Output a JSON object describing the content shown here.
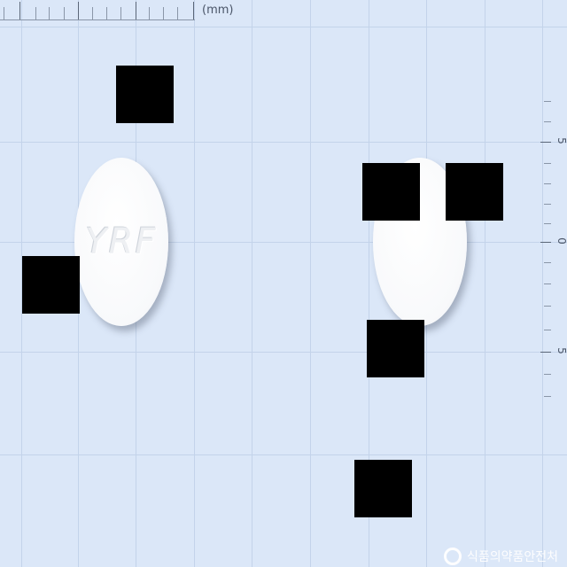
{
  "ruler": {
    "unit_label": "(mm)",
    "right_labels": [
      "5",
      "0",
      "5"
    ]
  },
  "pills": [
    {
      "name": "front",
      "imprint": "YRF"
    },
    {
      "name": "back",
      "imprint": ""
    }
  ],
  "watermark": {
    "text": "식품의약품안전처"
  }
}
